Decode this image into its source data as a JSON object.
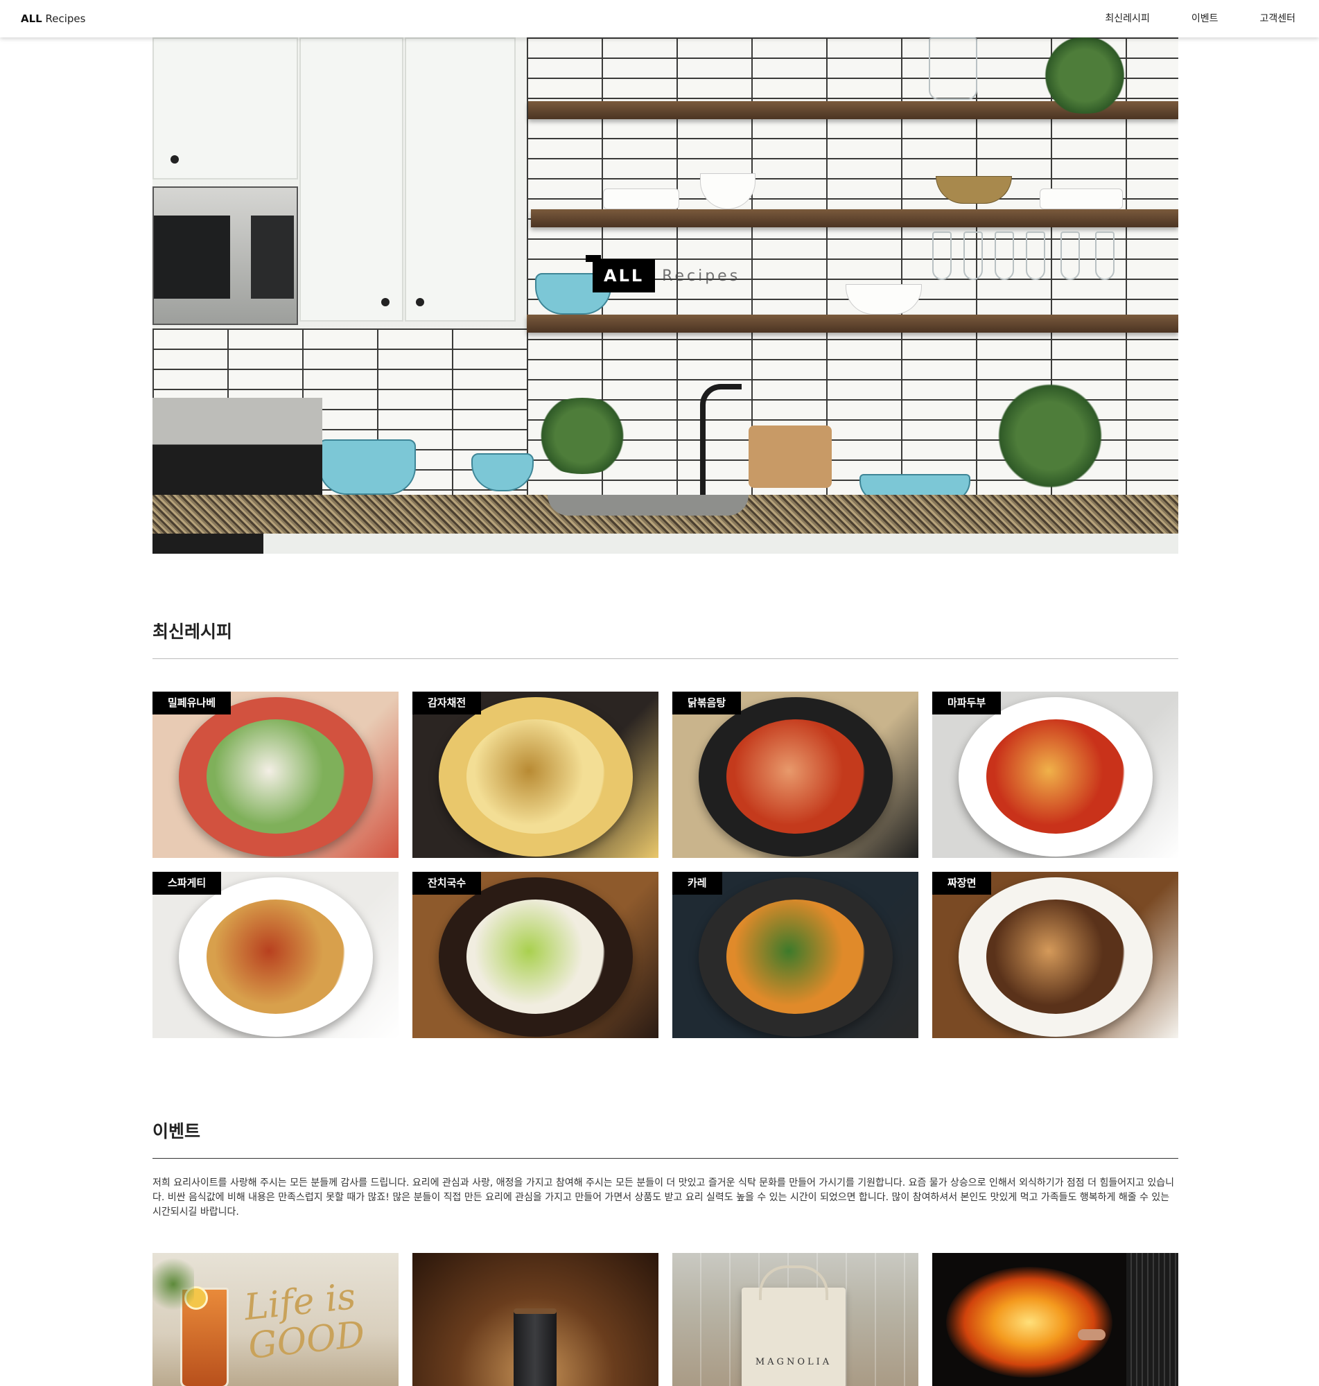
{
  "header": {
    "logo_bold": "ALL",
    "logo_rest": "Recipes",
    "nav": [
      "최신레시피",
      "이벤트",
      "고객센터"
    ]
  },
  "hero": {
    "brand_bold": "ALL",
    "brand_rest": "Recipes"
  },
  "recipes": {
    "title": "최신레시피",
    "items": [
      {
        "name": "밀페유나베",
        "palette": [
          "#e8cbb4",
          "#d2523f",
          "#7fb05a",
          "#f4efe6"
        ]
      },
      {
        "name": "감자채전",
        "palette": [
          "#2b2522",
          "#e9c76b",
          "#f3de95",
          "#b88a33"
        ]
      },
      {
        "name": "닭볶음탕",
        "palette": [
          "#c9b48c",
          "#1f1f1f",
          "#c43a1c",
          "#e89a6c"
        ]
      },
      {
        "name": "마파두부",
        "palette": [
          "#d8d8d6",
          "#ffffff",
          "#c9321a",
          "#f0b24a"
        ]
      },
      {
        "name": "스파게티",
        "palette": [
          "#ecebe8",
          "#ffffff",
          "#d8a04c",
          "#b8401f"
        ]
      },
      {
        "name": "잔치국수",
        "palette": [
          "#8e5a2c",
          "#2a1b14",
          "#f1ede0",
          "#a9d04e"
        ]
      },
      {
        "name": "카레",
        "palette": [
          "#1f2a33",
          "#2a2a2a",
          "#e08a2a",
          "#3d7a2b"
        ]
      },
      {
        "name": "짜장면",
        "palette": [
          "#7a4a24",
          "#f6f4ef",
          "#5a321a",
          "#d59a5a"
        ]
      }
    ]
  },
  "events": {
    "title": "이벤트",
    "description": "저희 요리사이트를 사랑해 주시는 모든 분들께 감사를 드립니다. 요리에 관심과 사랑, 애정을 가지고 참여해 주시는 모든 분들이 더 맛있고 즐거운 식탁 문화를 만들어 가시기를 기원합니다. 요즘 물가 상승으로 인해서 외식하기가 점점 더 힘들어지고 있습니다. 비싼 음식값에 비해 내용은 만족스럽지 못할 때가 많죠! 많은 분들이 직접 만든 요리에 관심을 가지고 만들어 가면서 상품도 받고 요리 실력도 높을 수 있는 시간이 되었으면 합니다. 많이 참여하셔서 본인도 맛있게 먹고 가족들도 행복하게 해줄 수 있는 시간되시길 바랍니다.",
    "items": [
      {
        "name": "iced-tea-life-is-good",
        "caption": "Life is GOOD"
      },
      {
        "name": "coffee-cup",
        "caption": ""
      },
      {
        "name": "magnolia-bag",
        "caption": "MAGNOLIA"
      },
      {
        "name": "flame-wok",
        "caption": ""
      }
    ]
  }
}
